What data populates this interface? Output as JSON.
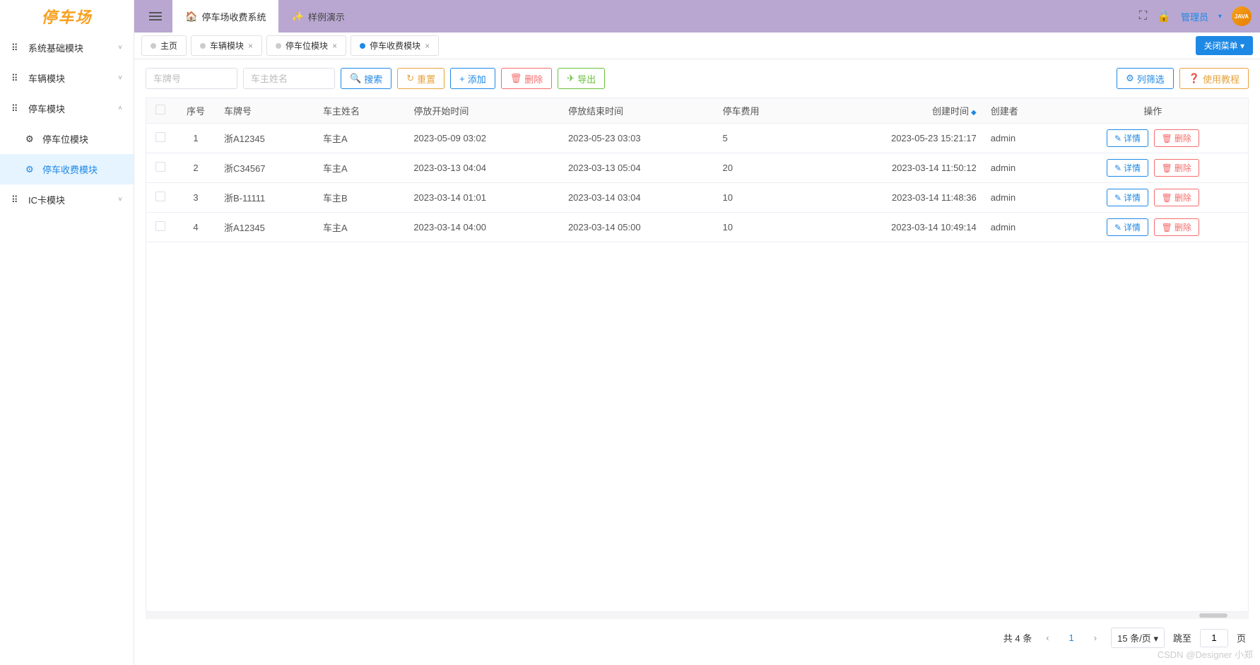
{
  "logo": "停车场",
  "header": {
    "tabs": [
      {
        "icon": "🏠",
        "label": "停车场收费系统",
        "active": true
      },
      {
        "icon": "✨",
        "label": "样例演示",
        "active": false
      }
    ],
    "user": "管理员",
    "avatar_text": "JAVA"
  },
  "sidebar": {
    "items": [
      {
        "icon": "grid",
        "label": "系统基础模块",
        "caret": "down",
        "active": false
      },
      {
        "icon": "grid",
        "label": "车辆模块",
        "caret": "down",
        "active": false
      },
      {
        "icon": "grid",
        "label": "停车模块",
        "caret": "up",
        "active": false,
        "children": [
          {
            "icon": "gear",
            "label": "停车位模块",
            "active": false
          },
          {
            "icon": "gear",
            "label": "停车收费模块",
            "active": true
          }
        ]
      },
      {
        "icon": "grid",
        "label": "IC卡模块",
        "caret": "down",
        "active": false
      }
    ]
  },
  "tabs": [
    {
      "label": "主页",
      "closable": false,
      "active": false
    },
    {
      "label": "车辆模块",
      "closable": true,
      "active": false
    },
    {
      "label": "停车位模块",
      "closable": true,
      "active": false
    },
    {
      "label": "停车收费模块",
      "closable": true,
      "active": true
    }
  ],
  "close_menu_label": "关闭菜单 ▾",
  "toolbar": {
    "plate_placeholder": "车牌号",
    "owner_placeholder": "车主姓名",
    "search": "搜索",
    "reset": "重置",
    "add": "添加",
    "delete": "删除",
    "export": "导出",
    "col_filter": "列筛选",
    "tutorial": "使用教程"
  },
  "table": {
    "headers": {
      "idx": "序号",
      "plate": "车牌号",
      "owner": "车主姓名",
      "start": "停放开始时间",
      "end": "停放结束时间",
      "fee": "停车费用",
      "created": "创建时间",
      "creator": "创建者",
      "action": "操作"
    },
    "rows": [
      {
        "idx": 1,
        "plate": "浙A12345",
        "owner": "车主A",
        "start": "2023-05-09 03:02",
        "end": "2023-05-23 03:03",
        "fee": "5",
        "created": "2023-05-23 15:21:17",
        "creator": "admin"
      },
      {
        "idx": 2,
        "plate": "浙C34567",
        "owner": "车主A",
        "start": "2023-03-13 04:04",
        "end": "2023-03-13 05:04",
        "fee": "20",
        "created": "2023-03-14 11:50:12",
        "creator": "admin"
      },
      {
        "idx": 3,
        "plate": "浙B-11111",
        "owner": "车主B",
        "start": "2023-03-14 01:01",
        "end": "2023-03-14 03:04",
        "fee": "10",
        "created": "2023-03-14 11:48:36",
        "creator": "admin"
      },
      {
        "idx": 4,
        "plate": "浙A12345",
        "owner": "车主A",
        "start": "2023-03-14 04:00",
        "end": "2023-03-14 05:00",
        "fee": "10",
        "created": "2023-03-14 10:49:14",
        "creator": "admin"
      }
    ],
    "action_detail": "详情",
    "action_delete": "删除"
  },
  "pagination": {
    "total_label": "共 4 条",
    "current": "1",
    "page_size": "15 条/页",
    "jump_label": "跳至",
    "jump_value": "1",
    "page_suffix": "页"
  },
  "watermark": "CSDN @Designer 小郑"
}
